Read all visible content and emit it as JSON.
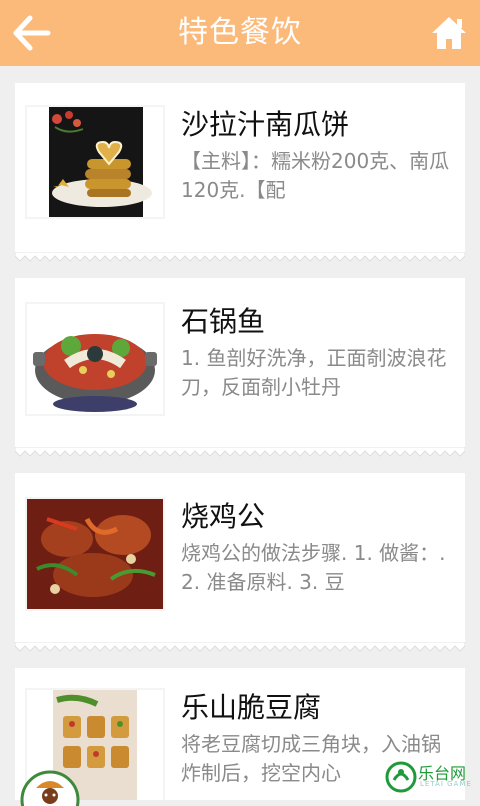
{
  "header": {
    "title": "特色餐饮",
    "back_icon": "back-arrow-icon",
    "home_icon": "home-icon",
    "bar_color": "#fbb97a"
  },
  "dishes": [
    {
      "name": "沙拉汁南瓜饼",
      "description": "【主料】：糯米粉200克、南瓜120克.【配"
    },
    {
      "name": "石锅鱼",
      "description": " 1. 鱼剖好洗净，正面剞波浪花刀，反面剞小牡丹"
    },
    {
      "name": "烧鸡公",
      "description": " 烧鸡公的做法步骤. 1. 做酱：. 2. 准备原料. 3. 豆"
    },
    {
      "name": "乐山脆豆腐",
      "description": "将老豆腐切成三角块，入油锅炸制后，挖空内心"
    }
  ],
  "watermark": {
    "text": "乐台网",
    "sub": "LETAI GAME"
  }
}
